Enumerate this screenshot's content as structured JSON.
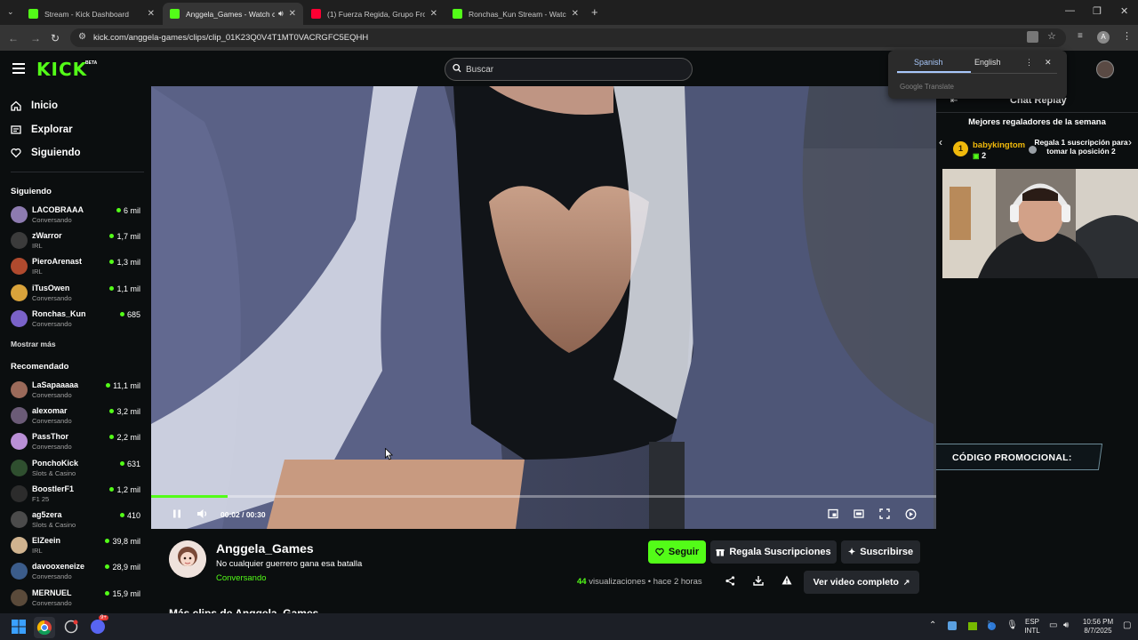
{
  "browser": {
    "tabs": [
      {
        "title": "Stream - Kick Dashboard",
        "active": false
      },
      {
        "title": "Anggela_Games - Watch cli",
        "active": true
      },
      {
        "title": "(1) Fuerza Regida, Grupo Fronte",
        "active": false
      },
      {
        "title": "Ronchas_Kun Stream - Watch Li",
        "active": false
      }
    ],
    "url": "kick.com/anggela-games/clips/clip_01K23Q0V4T1MT0VACRGFC5EQHH"
  },
  "header": {
    "logo": "KICK",
    "logo_badge": "BETA",
    "search_placeholder": "Buscar"
  },
  "translate_popup": {
    "lang_from": "Spanish",
    "lang_to": "English",
    "brand": "Google Translate"
  },
  "sidebar": {
    "nav": [
      {
        "label": "Inicio",
        "icon": "home-icon"
      },
      {
        "label": "Explorar",
        "icon": "compass-icon"
      },
      {
        "label": "Siguiendo",
        "icon": "heart-icon"
      }
    ],
    "following_title": "Siguiendo",
    "following": [
      {
        "name": "LACOBRAAA",
        "category": "Conversando",
        "viewers": "6 mil",
        "color": "#8d7bb0"
      },
      {
        "name": "zWarror",
        "category": "IRL",
        "viewers": "1,7 mil",
        "color": "#3b3b3b"
      },
      {
        "name": "PieroArenast",
        "category": "IRL",
        "viewers": "1,3 mil",
        "color": "#b04a2e"
      },
      {
        "name": "iTusOwen",
        "category": "Conversando",
        "viewers": "1,1 mil",
        "color": "#d9a33b"
      },
      {
        "name": "Ronchas_Kun",
        "category": "Conversando",
        "viewers": "685",
        "color": "#7a62c9"
      }
    ],
    "show_more": "Mostrar más",
    "recommended_title": "Recomendado",
    "recommended": [
      {
        "name": "LaSapaaaaa",
        "category": "Conversando",
        "viewers": "11,1 mil",
        "color": "#9b6a5a"
      },
      {
        "name": "alexomar",
        "category": "Conversando",
        "viewers": "3,2 mil",
        "color": "#6b5b77"
      },
      {
        "name": "PassThor",
        "category": "Conversando",
        "viewers": "2,2 mil",
        "color": "#b98fd6"
      },
      {
        "name": "PonchoKick",
        "category": "Slots & Casino",
        "viewers": "631",
        "color": "#2f4f2f"
      },
      {
        "name": "BoostlerF1",
        "category": "F1 25",
        "viewers": "1,2 mil",
        "color": "#2c2c2c"
      },
      {
        "name": "ag5zera",
        "category": "Slots & Casino",
        "viewers": "410",
        "color": "#4b4b4b"
      },
      {
        "name": "ElZeein",
        "category": "IRL",
        "viewers": "39,8 mil",
        "color": "#d0b38f"
      },
      {
        "name": "davooxeneize",
        "category": "Conversando",
        "viewers": "28,9 mil",
        "color": "#3b5c8a"
      },
      {
        "name": "MERNUEL",
        "category": "Conversando",
        "viewers": "15,9 mil",
        "color": "#5a4a3a"
      }
    ]
  },
  "player": {
    "time": "00:02 / 00:30",
    "progress": 0.097
  },
  "clip": {
    "streamer": "Anggela_Games",
    "title": "No cualquier guerrero gana esa batalla",
    "category": "Conversando",
    "views_count": "44",
    "views_label": "visualizaciones",
    "age": "• hace 2 horas",
    "follow": "Seguir",
    "gift_subs": "Regala Suscripciones",
    "subscribe": "Suscribirse",
    "full_video": "Ver video completo",
    "more_clips": "Más clips de Anggela_Games"
  },
  "chat": {
    "title": "Chat Replay",
    "gifters_title": "Mejores regaladores de la semana",
    "top_gifter_rank": "1",
    "top_gifter_name": "babykingtom",
    "top_gifter_count": "2",
    "gift_cta": "Regala 1 suscripción para tomar la posición 2",
    "promo": "CÓDIGO PROMOCIONAL:"
  },
  "taskbar": {
    "lang_top": "ESP",
    "lang_bottom": "INTL",
    "time": "10:56 PM",
    "date": "8/7/2025",
    "discord_badge": "9+"
  }
}
